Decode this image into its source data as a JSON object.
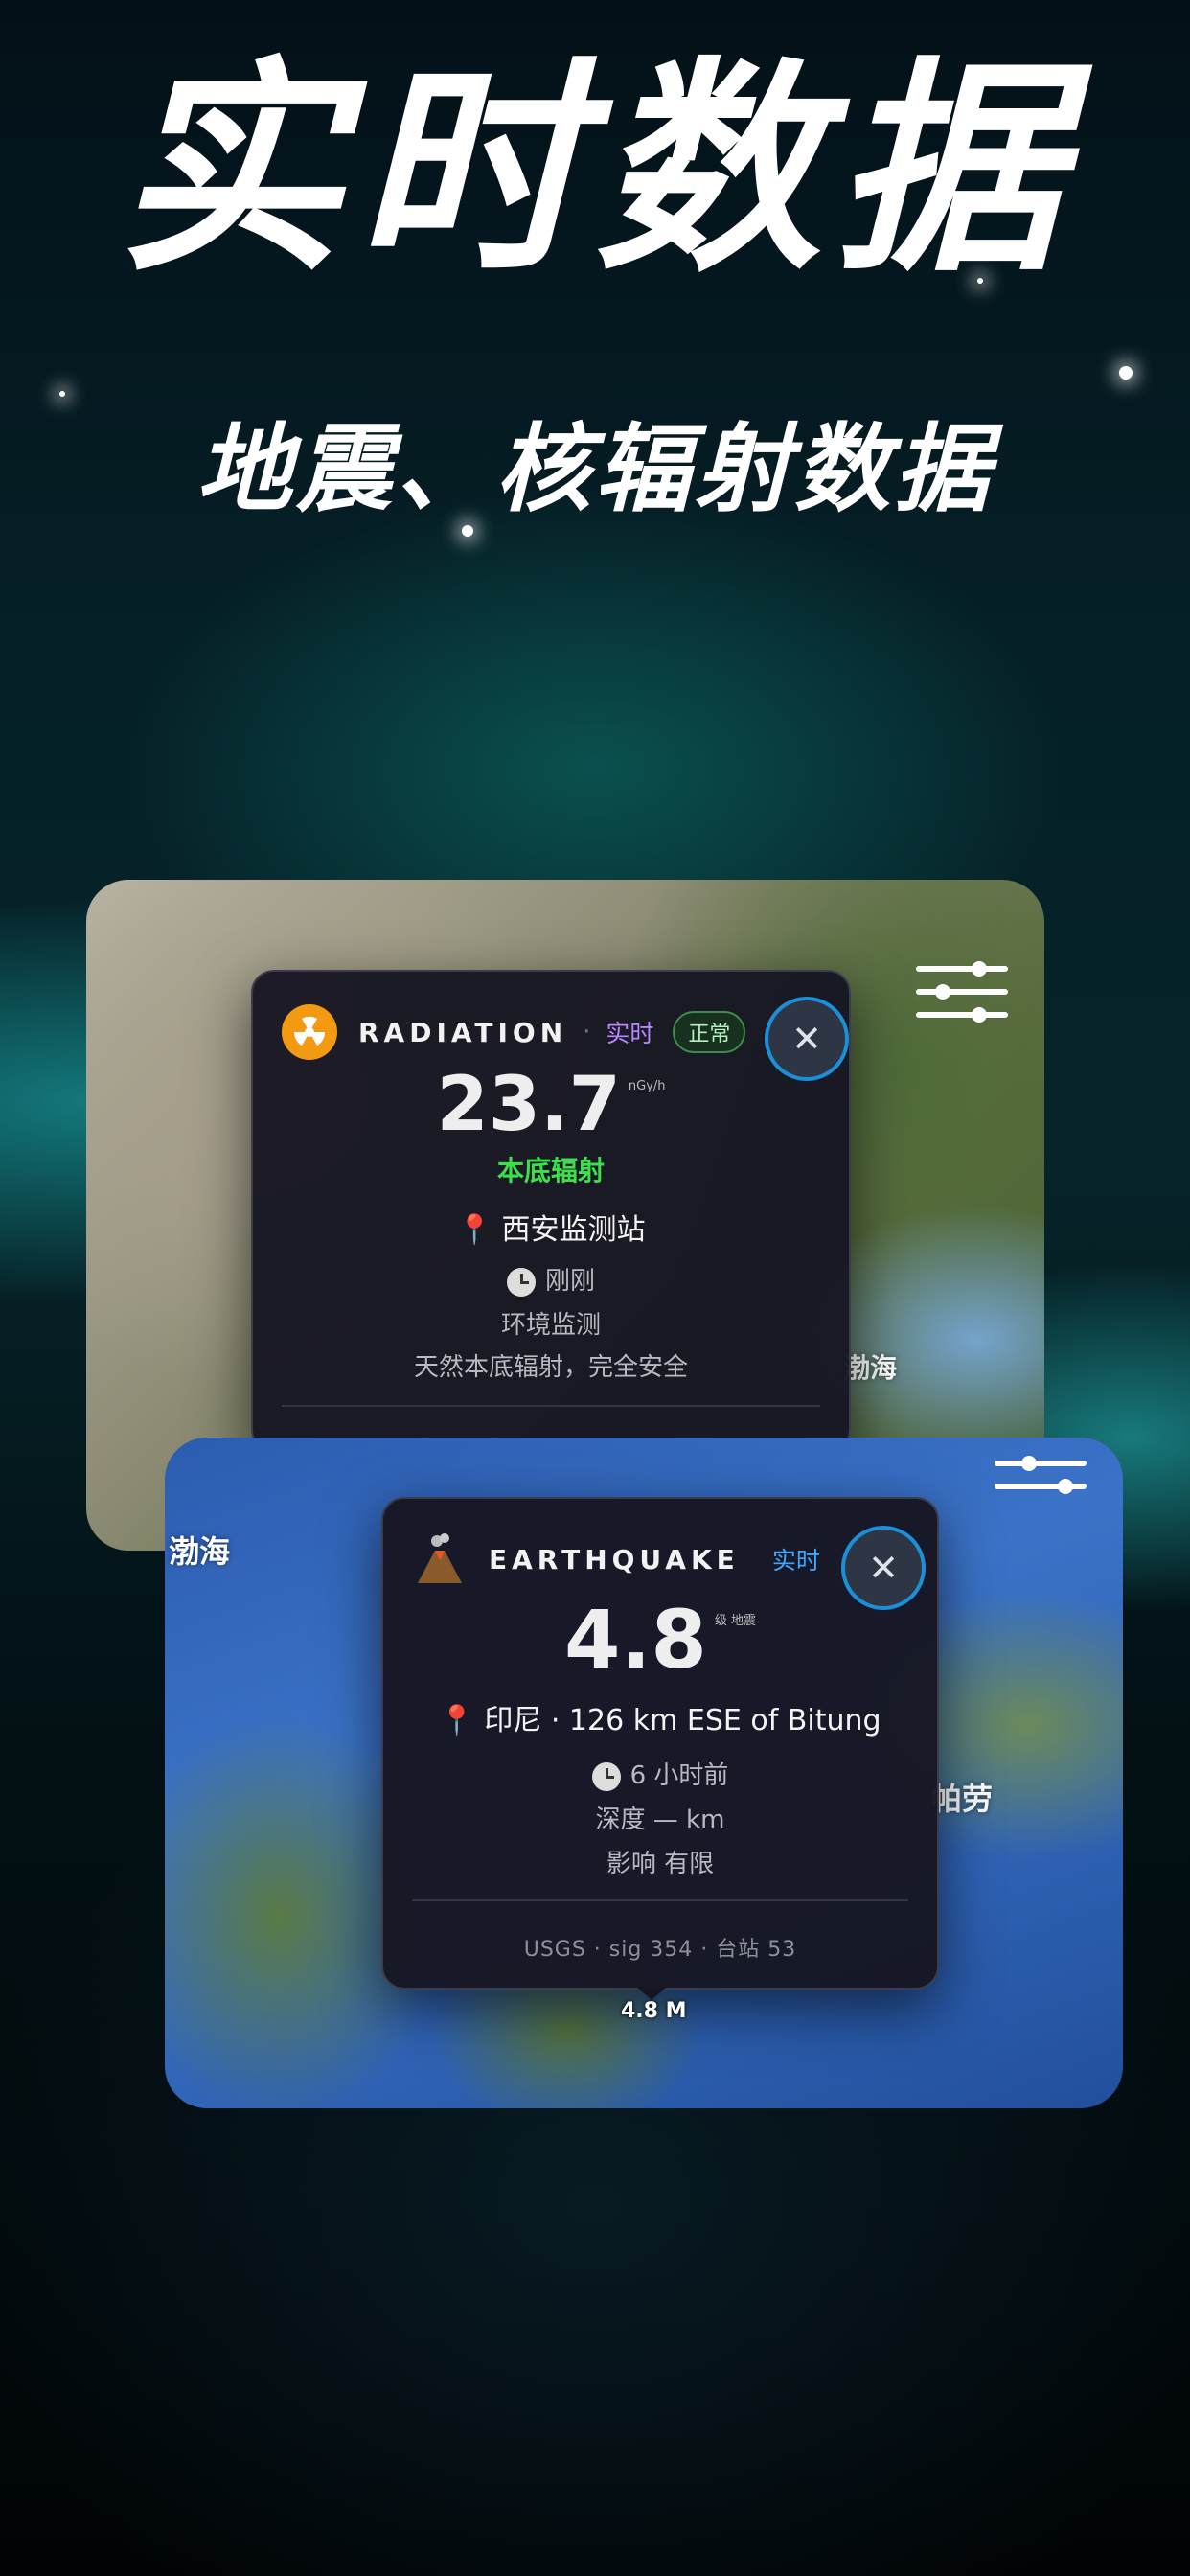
{
  "hero": {
    "title": "实时数据",
    "subtitle": "地震、核辐射数据"
  },
  "radiation_card": {
    "kind": "RADIATION",
    "dot": "·",
    "live_label": "实时",
    "status": "正常",
    "value": "23.7",
    "unit": "nGy/h",
    "level_text": "本底辐射",
    "station": "西安监测站",
    "time": "刚刚",
    "category": "环境监测",
    "description": "天然本底辐射，完全安全",
    "close_symbol": "✕",
    "icon": "radiation-icon",
    "accent_live": "#b685ff",
    "accent_level": "#3be04a"
  },
  "earthquake_card": {
    "kind": "EARTHQUAKE",
    "live_label": "实时",
    "magnitude": "4.8",
    "magnitude_unit": "级 地震",
    "location": "印尼 · 126 km ESE of Bitung",
    "time": "6 小时前",
    "depth": "深度 — km",
    "impact": "影响 有限",
    "footer": "USGS · sig 354 · 台站 53",
    "close_symbol": "✕",
    "icon": "volcano-icon",
    "accent_live": "#3ea6ff"
  },
  "map_labels": {
    "sea_1": "渤海",
    "sea_2": "渤海",
    "palau": "帕劳",
    "marker": "4.8 M"
  },
  "pin_symbol": "📍"
}
